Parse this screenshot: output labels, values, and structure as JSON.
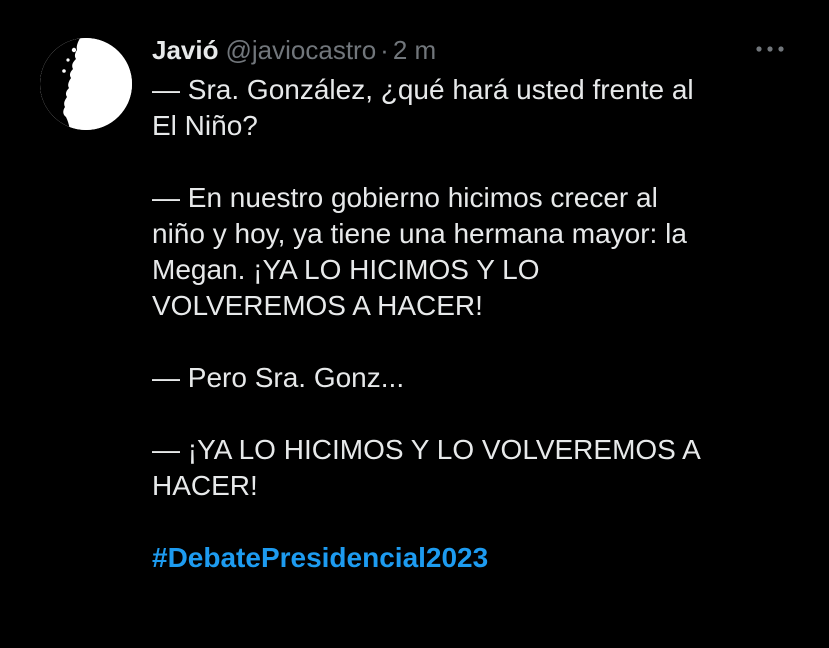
{
  "colors": {
    "background": "#000000",
    "text": "#e7e9ea",
    "muted": "#71767b",
    "link": "#1d9bf0"
  },
  "author": {
    "display_name": "Javió",
    "handle": "@javiocastro",
    "separator": "·",
    "time": "2 m",
    "avatar_icon": "silhouette-profile-icon"
  },
  "actions": {
    "more_icon": "more-options-icon"
  },
  "tweet": {
    "para1": {
      "line1": "— Sra. González, ¿qué hará usted frente al",
      "line2": "El Niño?"
    },
    "para2": {
      "line1": "— En nuestro gobierno hicimos crecer al",
      "line2": "niño y hoy, ya tiene una hermana mayor: la",
      "line3": "Megan. ¡YA LO HICIMOS Y LO",
      "line4": "VOLVEREMOS A HACER!"
    },
    "para3": {
      "line1": "— Pero Sra. Gonz..."
    },
    "para4": {
      "line1": "— ¡YA LO HICIMOS Y LO VOLVEREMOS A",
      "line2": "HACER!"
    },
    "hashtag": "#DebatePresidencial2023"
  }
}
